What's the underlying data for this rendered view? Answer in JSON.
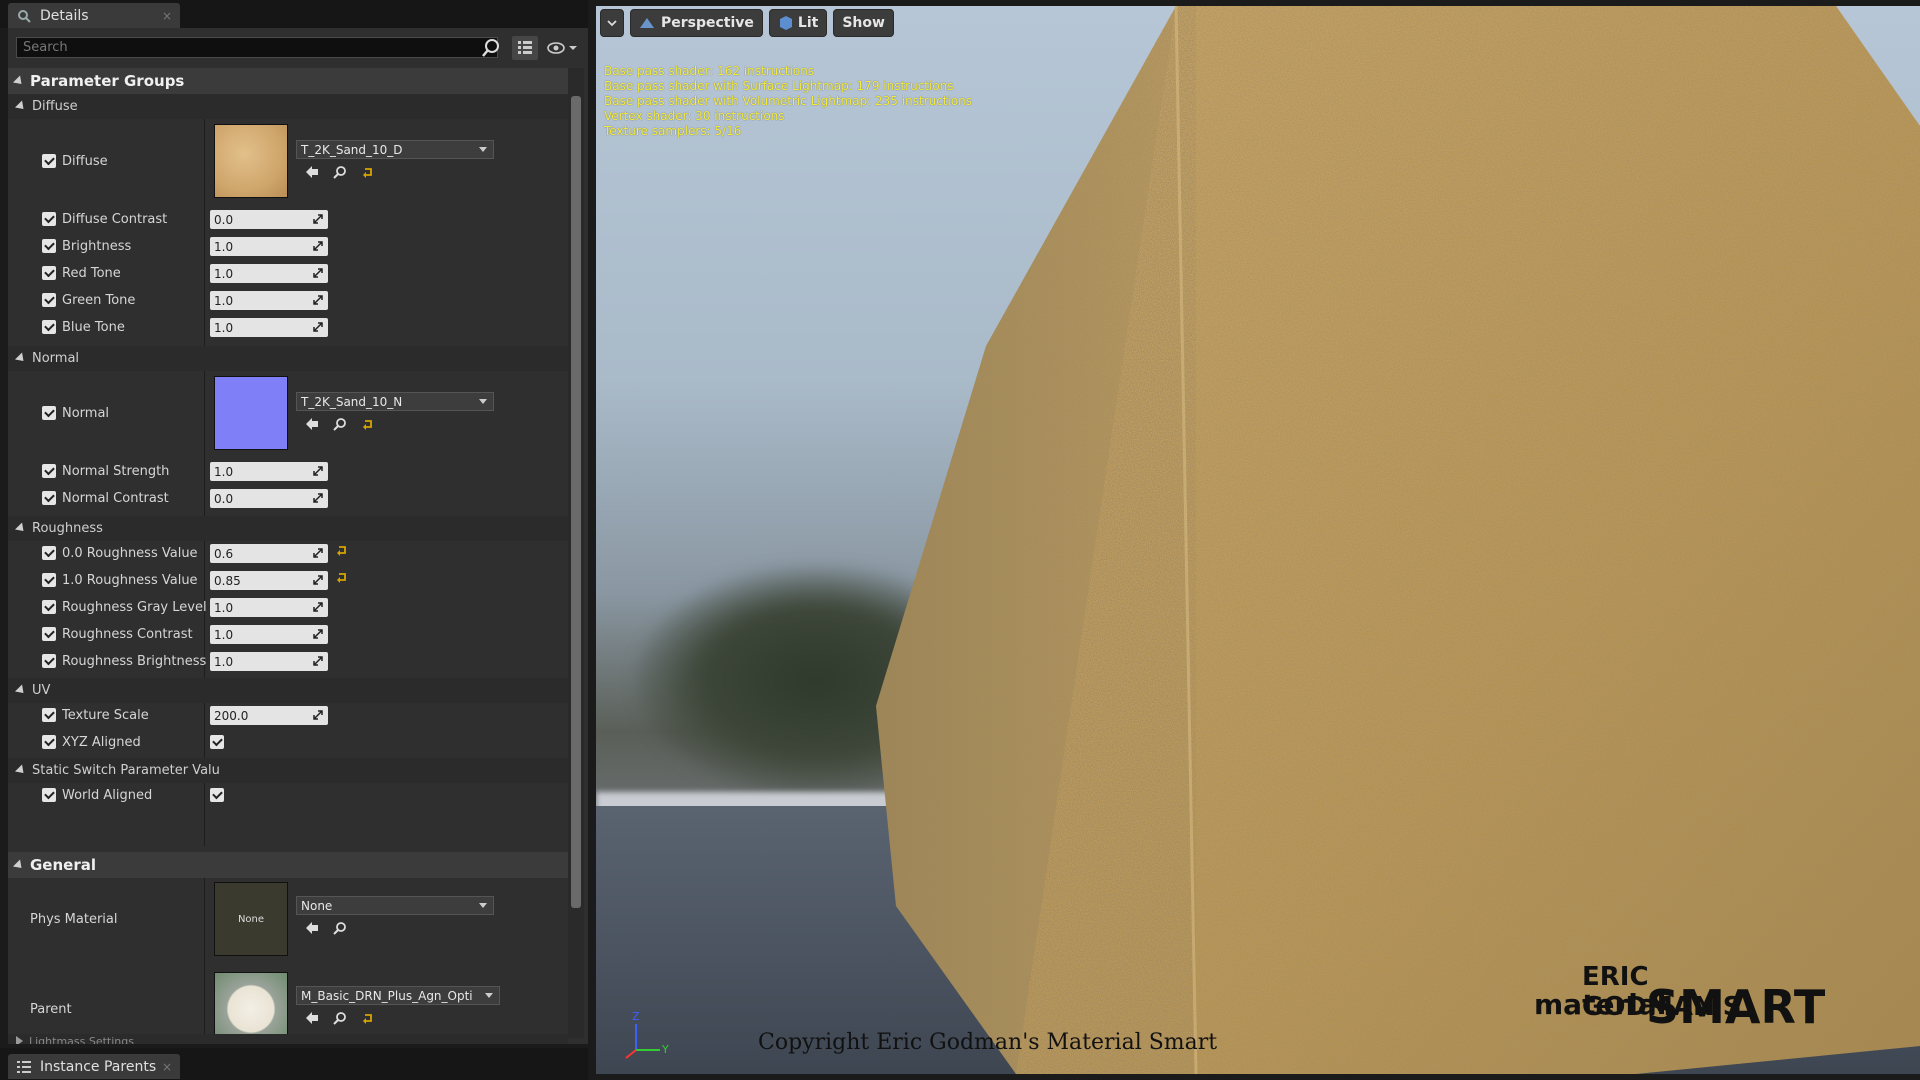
{
  "details_tab": {
    "title": "Details",
    "close": "×"
  },
  "bottom_tab": {
    "title": "Instance Parents",
    "close": "×"
  },
  "search": {
    "placeholder": "Search"
  },
  "sections": {
    "parameter_groups": "Parameter Groups",
    "general": "General"
  },
  "groups": {
    "diffuse": "Diffuse",
    "normal": "Normal",
    "roughness": "Roughness",
    "uv": "UV",
    "static_switch": "Static Switch Parameter Valu",
    "lightmass": "Lightmass Settings"
  },
  "diffuse": {
    "texture_label": "Diffuse",
    "texture_asset": "T_2K_Sand_10_D",
    "params": [
      {
        "label": "Diffuse Contrast",
        "value": "0.0"
      },
      {
        "label": "Brightness",
        "value": "1.0"
      },
      {
        "label": "Red Tone",
        "value": "1.0"
      },
      {
        "label": "Green Tone",
        "value": "1.0"
      },
      {
        "label": "Blue Tone",
        "value": "1.0"
      }
    ]
  },
  "normal": {
    "texture_label": "Normal",
    "texture_asset": "T_2K_Sand_10_N",
    "params": [
      {
        "label": "Normal Strength",
        "value": "1.0"
      },
      {
        "label": "Normal Contrast",
        "value": "0.0"
      }
    ]
  },
  "roughness": {
    "params": [
      {
        "label": "0.0 Roughness Value",
        "value": "0.6"
      },
      {
        "label": "1.0 Roughness Value",
        "value": "0.85"
      },
      {
        "label": "Roughness Gray Level",
        "value": "1.0"
      },
      {
        "label": "Roughness Contrast",
        "value": "1.0"
      },
      {
        "label": "Roughness Brightness",
        "value": "1.0"
      }
    ]
  },
  "uv": {
    "texture_scale_label": "Texture Scale",
    "texture_scale_value": "200.0",
    "xyz_aligned_label": "XYZ Aligned"
  },
  "static_switch": {
    "world_aligned_label": "World Aligned"
  },
  "general": {
    "phys_material_label": "Phys Material",
    "phys_material_thumb": "None",
    "phys_material_value": "None",
    "parent_label": "Parent",
    "parent_value": "M_Basic_DRN_Plus_Agn_Opti"
  },
  "viewport": {
    "perspective": "Perspective",
    "lit": "Lit",
    "show": "Show",
    "stats": [
      "Base pass shader: 162 instructions",
      "Base pass shader with Surface Lightmap: 179 instructions",
      "Base pass shader with Volumetric Lightmap: 235 instructions",
      "Vertex shader: 30 instructions",
      "Texture samplers: 5/16"
    ],
    "copyright": "Copyright Eric Godman's Material Smart",
    "logo_line1": "ERIC GODMAN'S",
    "logo_line2": "material",
    "logo_line3": "SMART",
    "axis_y": "Y",
    "axis_z": "Z"
  },
  "colors": {
    "accent_yellow": "#f5ec3c",
    "reset_arrow": "#d7a400",
    "diffuse_thumb": "#d9b27a",
    "normal_thumb": "#7f7ff7"
  }
}
